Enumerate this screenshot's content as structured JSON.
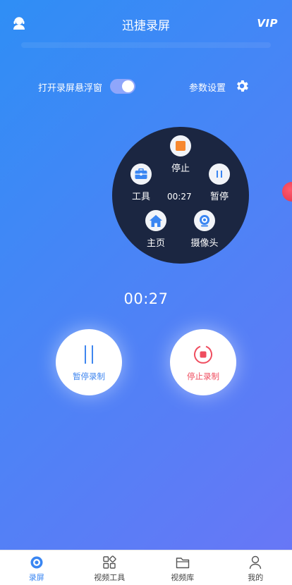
{
  "header": {
    "title": "迅捷录屏",
    "vip_label": "VIP"
  },
  "settings": {
    "floating_window_label": "打开录屏悬浮窗",
    "floating_window_enabled": true,
    "params_label": "参数设置"
  },
  "float_menu": {
    "stop_label": "停止",
    "pause_label": "暂停",
    "tools_label": "工具",
    "home_label": "主页",
    "camera_label": "摄像头",
    "time": "00:27"
  },
  "timer": "00:27",
  "controls": {
    "pause_label": "暂停录制",
    "stop_label": "停止录制"
  },
  "nav": {
    "items": [
      {
        "label": "录屏",
        "icon": "record-icon",
        "active": true
      },
      {
        "label": "视频工具",
        "icon": "grid-tools-icon",
        "active": false
      },
      {
        "label": "视频库",
        "icon": "folder-icon",
        "active": false
      },
      {
        "label": "我的",
        "icon": "person-icon",
        "active": false
      }
    ]
  },
  "colors": {
    "accent": "#3a86f2",
    "menu_bg": "#1b2641",
    "stop_red": "#ef4d5f",
    "stop_orange": "#f7882f"
  }
}
